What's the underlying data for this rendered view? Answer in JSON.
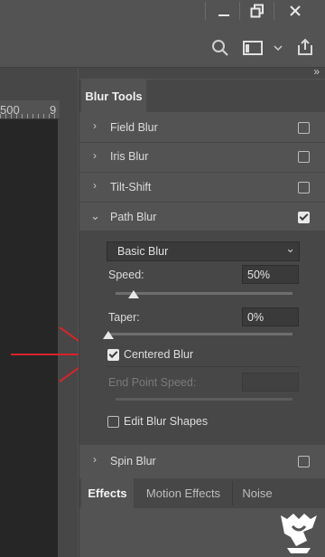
{
  "window": {
    "buttons": {
      "minimize": "—",
      "restore": "⧉",
      "close": "✕"
    }
  },
  "options_bar": {
    "icons": [
      "search-icon",
      "workspace-icon",
      "chevron-down-icon",
      "share-icon"
    ],
    "search_glyph": "⚲",
    "chevron_glyph": "⌵"
  },
  "ruler": {
    "label_500": "500",
    "label_9": "9"
  },
  "panel": {
    "collapse_glyph": "»",
    "tab": "Blur Tools",
    "items": [
      {
        "label": "Field Blur",
        "checked": false,
        "chevron": "›"
      },
      {
        "label": "Iris Blur",
        "checked": false,
        "chevron": "›"
      },
      {
        "label": "Tilt-Shift",
        "checked": false,
        "chevron": "›"
      },
      {
        "label": "Path Blur",
        "checked": true,
        "chevron": "⌄"
      }
    ],
    "path_blur": {
      "mode": "Basic Blur",
      "mode_chevron": "⌄",
      "speed_label": "Speed:",
      "speed_value": "50%",
      "speed_fraction": 0.1,
      "taper_label": "Taper:",
      "taper_value": "0%",
      "taper_fraction": 0.0,
      "centered_blur": "Centered Blur",
      "centered_checked": true,
      "end_point_speed": "End Point Speed:",
      "edit_blur_shapes": "Edit Blur Shapes",
      "edit_checked": false
    },
    "spin_blur": {
      "label": "Spin Blur",
      "checked": false,
      "chevron": "›"
    }
  },
  "lower_tabs": [
    "Effects",
    "Motion Effects",
    "Noise"
  ],
  "colors": {
    "annotation_arrow": "#d8232a",
    "panel_bg": "#535353",
    "subpanel_bg": "#474747"
  }
}
